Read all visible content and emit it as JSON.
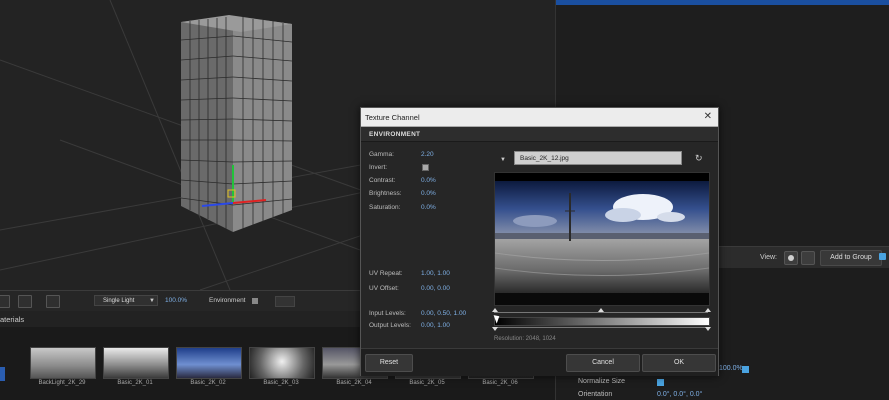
{
  "toolbar": {
    "light_mode": "Single Light",
    "zoom": "100.0%",
    "environment_label": "Environment"
  },
  "materials": {
    "title": "aterials",
    "items": [
      {
        "label": "BackLight_2K_29"
      },
      {
        "label": "Basic_2K_01"
      },
      {
        "label": "Basic_2K_02"
      },
      {
        "label": "Basic_2K_03"
      },
      {
        "label": "Basic_2K_04"
      },
      {
        "label": "Basic_2K_05"
      },
      {
        "label": "Basic_2K_06"
      }
    ]
  },
  "right_panel": {
    "view_label": "View:",
    "add_to_group": "Add to Group",
    "value_100": "100.0%",
    "normalize_size": "Normalize Size",
    "orientation_label": "Orientation",
    "orientation_values": "0.0°,  0.0°,  0.0°"
  },
  "dialog": {
    "title": "Texture Channel",
    "close_glyph": "✕",
    "section": "ENVIRONMENT",
    "params": {
      "gamma_label": "Gamma:",
      "gamma_value": "2.20",
      "invert_label": "Invert:",
      "contrast_label": "Contrast:",
      "contrast_value": "0.0%",
      "brightness_label": "Brightness:",
      "brightness_value": "0.0%",
      "saturation_label": "Saturation:",
      "saturation_value": "0.0%",
      "uv_repeat_label": "UV Repeat:",
      "uv_repeat_value": "1.00,  1.00",
      "uv_offset_label": "UV Offset:",
      "uv_offset_value": "0.00,  0.00",
      "input_levels_label": "Input Levels:",
      "input_levels_value": "0.00,  0.50,  1.00",
      "output_levels_label": "Output Levels:",
      "output_levels_value": "0.00,  1.00"
    },
    "file_name": "Basic_2K_12.jpg",
    "resolution": "Resolution: 2048, 1024",
    "buttons": {
      "reset": "Reset",
      "cancel": "Cancel",
      "ok": "OK"
    }
  }
}
